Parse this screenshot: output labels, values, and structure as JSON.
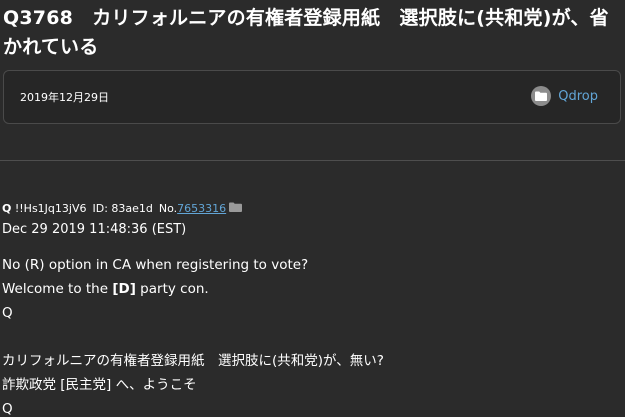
{
  "title": "Q3768　カリフォルニアの有権者登録用紙　選択肢に(共和党)が、省かれている",
  "meta": {
    "date": "2019年12月29日",
    "source_icon": "folder-icon",
    "source_label": "Qdrop"
  },
  "post": {
    "author": "Q",
    "tripcode": "!!Hs1Jq13jV6",
    "id_label": "ID:",
    "id_value": "83ae1d",
    "no_label": "No.",
    "no_value": "7653316",
    "timestamp": "Dec 29 2019 11:48:36 (EST)",
    "body": {
      "line1": "No (R) option in CA when registering to vote?",
      "line2_pre": "Welcome to the ",
      "line2_bold": "[D]",
      "line2_post": " party con.",
      "line3": "Q",
      "line4": "カリフォルニアの有権者登録用紙　選択肢に(共和党)が、無い?",
      "line5": "詐欺政党 [民主党] へ、ようこそ",
      "line6": "Q"
    }
  },
  "colors": {
    "background": "#2b2b2b",
    "panel": "#262626",
    "link": "#62a5d6",
    "text": "#ffffff"
  }
}
